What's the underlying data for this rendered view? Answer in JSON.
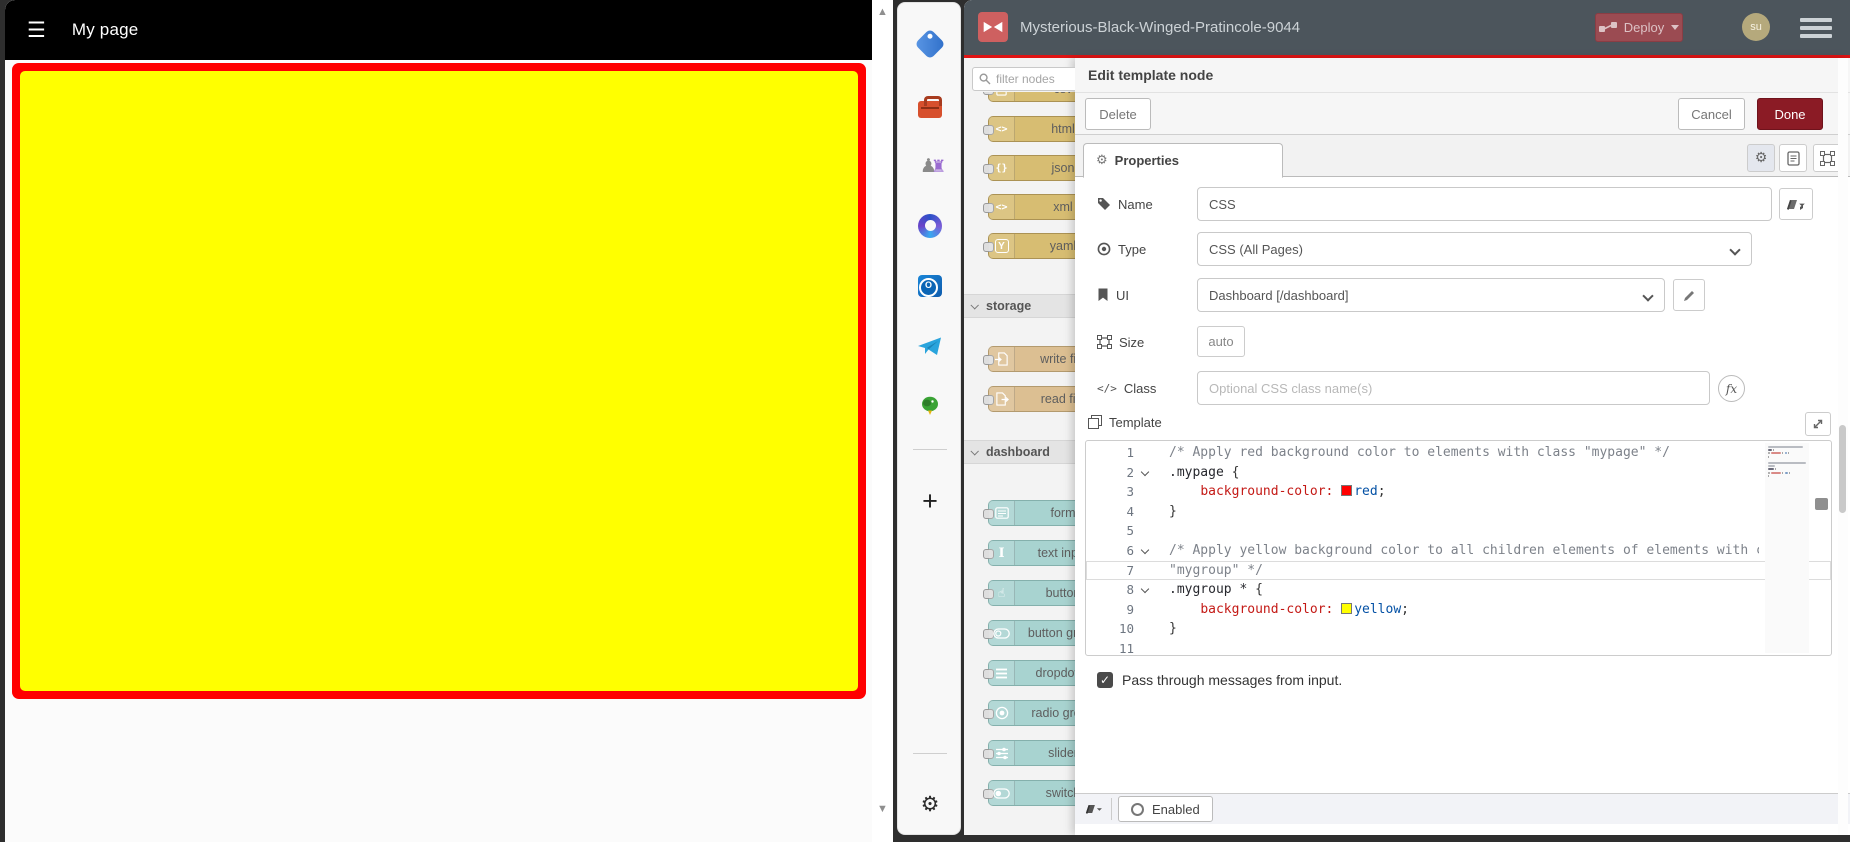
{
  "left_pane": {
    "title": "My page",
    "page_bg": "#ffff00",
    "page_border": "#ff0000"
  },
  "sidebar": {
    "icons": [
      "tag",
      "toolbox",
      "games",
      "office-loop",
      "outlook",
      "telegram",
      "bird"
    ],
    "footer_icons": [
      "add",
      "settings"
    ]
  },
  "nodered": {
    "header": {
      "title": "Mysterious-Black-Winged-Pratincole-9044",
      "deploy_label": "Deploy",
      "avatar_initials": "su",
      "bg": "#4c555c",
      "accent_line": "#e01313"
    },
    "palette": {
      "search_placeholder": "filter nodes",
      "sections": [
        {
          "label": null,
          "nodes": [
            {
              "label": "csv",
              "kind": "parser",
              "icon": "file-lines"
            },
            {
              "label": "html",
              "kind": "parser",
              "icon": "angle-brackets"
            },
            {
              "label": "json",
              "kind": "parser",
              "icon": "braces"
            },
            {
              "label": "xml",
              "kind": "parser",
              "icon": "angle-brackets"
            },
            {
              "label": "yaml",
              "kind": "parser",
              "icon": "letter-y"
            }
          ]
        },
        {
          "label": "storage",
          "nodes": [
            {
              "label": "write file",
              "kind": "file",
              "icon": "file-arrow-in"
            },
            {
              "label": "read file",
              "kind": "file",
              "icon": "file-arrow-out"
            }
          ]
        },
        {
          "label": "dashboard",
          "nodes": [
            {
              "label": "form",
              "kind": "ui",
              "icon": "form"
            },
            {
              "label": "text input",
              "kind": "ui",
              "icon": "ibeam"
            },
            {
              "label": "button",
              "kind": "ui",
              "icon": "hand"
            },
            {
              "label": "button group",
              "kind": "ui",
              "icon": "toggle-outline"
            },
            {
              "label": "dropdown",
              "kind": "ui",
              "icon": "menu-lines"
            },
            {
              "label": "radio group",
              "kind": "ui",
              "icon": "radio"
            },
            {
              "label": "slider",
              "kind": "ui",
              "icon": "sliders"
            },
            {
              "label": "switch",
              "kind": "ui",
              "icon": "toggle-filled"
            }
          ]
        }
      ]
    },
    "tray": {
      "title": "Edit template node",
      "buttons": {
        "delete": "Delete",
        "cancel": "Cancel",
        "done": "Done"
      },
      "tab_label": "Properties",
      "fields": {
        "name_label": "Name",
        "name_value": "CSS",
        "type_label": "Type",
        "type_value": "CSS (All Pages)",
        "ui_label": "UI",
        "ui_value": "Dashboard [/dashboard]",
        "size_label": "Size",
        "size_value": "auto",
        "class_label": "Class",
        "class_placeholder": "Optional CSS class name(s)",
        "template_label": "Template"
      },
      "editor": {
        "lines": [
          {
            "num": 1,
            "tokens": [
              [
                "c",
                "/* Apply red background color to elements with class \"mypage\" */"
              ]
            ]
          },
          {
            "num": 2,
            "fold": true,
            "tokens": [
              [
                "s",
                ".mypage"
              ],
              [
                "n",
                " {"
              ]
            ]
          },
          {
            "num": 3,
            "tokens": [
              [
                "n",
                "    "
              ],
              [
                "p",
                "background-color:"
              ],
              [
                "n",
                " "
              ],
              [
                "sw",
                "#ff0000"
              ],
              [
                "v",
                "red"
              ],
              [
                "n",
                ";"
              ]
            ]
          },
          {
            "num": 4,
            "tokens": [
              [
                "n",
                "}"
              ]
            ]
          },
          {
            "num": 5,
            "tokens": []
          },
          {
            "num": 6,
            "fold": true,
            "tokens": [
              [
                "c",
                "/* Apply yellow background color to all children elements of elements with class"
              ]
            ]
          },
          {
            "num": 7,
            "current": true,
            "tokens": [
              [
                "c",
                "\"mygroup\" */"
              ]
            ]
          },
          {
            "num": 8,
            "fold": true,
            "tokens": [
              [
                "s",
                ".mygroup *"
              ],
              [
                "n",
                " {"
              ]
            ]
          },
          {
            "num": 9,
            "tokens": [
              [
                "n",
                "    "
              ],
              [
                "p",
                "background-color:"
              ],
              [
                "n",
                " "
              ],
              [
                "sw",
                "#ffff00"
              ],
              [
                "v",
                "yellow"
              ],
              [
                "n",
                ";"
              ]
            ]
          },
          {
            "num": 10,
            "tokens": [
              [
                "n",
                "}"
              ]
            ]
          },
          {
            "num": 11,
            "tokens": []
          }
        ]
      },
      "passthrough_label": "Pass through messages from input.",
      "enabled_label": "Enabled",
      "done_bg": "#8b1b25"
    }
  }
}
